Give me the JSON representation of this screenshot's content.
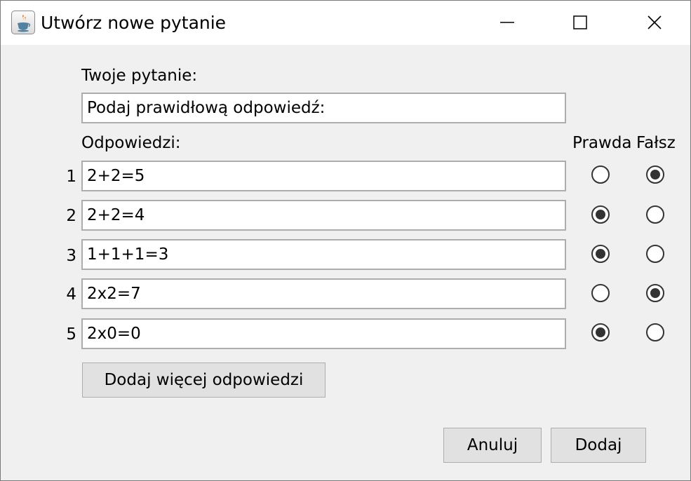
{
  "window": {
    "title": "Utwórz nowe pytanie",
    "icon": "java-cup-icon",
    "controls": [
      "minimize-icon",
      "maximize-icon",
      "close-icon"
    ]
  },
  "question": {
    "label": "Twoje pytanie:",
    "value": "Podaj prawidłową odpowiedź:"
  },
  "answers": {
    "label": "Odpowiedzi:",
    "true_header": "Prawda",
    "false_header": "Fałsz",
    "rows": [
      {
        "number": "1",
        "text": "2+2=5",
        "selected": "false"
      },
      {
        "number": "2",
        "text": "2+2=4",
        "selected": "true"
      },
      {
        "number": "3",
        "text": "1+1+1=3",
        "selected": "true"
      },
      {
        "number": "4",
        "text": "2x2=7",
        "selected": "false"
      },
      {
        "number": "5",
        "text": "2x0=0",
        "selected": "true"
      }
    ]
  },
  "buttons": {
    "add_more": "Dodaj więcej odpowiedzi",
    "cancel": "Anuluj",
    "add": "Dodaj"
  }
}
